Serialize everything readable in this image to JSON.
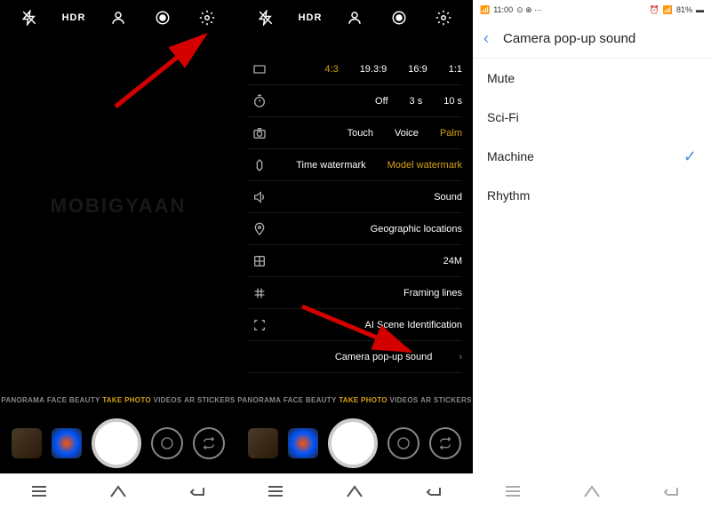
{
  "panel1": {
    "topbar": {
      "hdr": "HDR"
    },
    "modes": {
      "panorama": "PANORAMA",
      "facebeauty": "FACE BEAUTY",
      "takephoto": "TAKE PHOTO",
      "videos": "VIDEOS",
      "arstickers": "AR STICKERS"
    },
    "watermark": "MOBIGYAAN"
  },
  "panel2": {
    "topbar": {
      "hdr": "HDR"
    },
    "settings": {
      "ratio": {
        "o1": "4:3",
        "o2": "19.3:9",
        "o3": "16:9",
        "o4": "1:1"
      },
      "timer": {
        "o1": "Off",
        "o2": "3 s",
        "o3": "10 s"
      },
      "shutter": {
        "o1": "Touch",
        "o2": "Voice",
        "o3": "Palm"
      },
      "watermark": {
        "o1": "Time watermark",
        "o2": "Model watermark"
      },
      "sound": "Sound",
      "geo": "Geographic locations",
      "resolution": "24M",
      "framing": "Framing lines",
      "aiscene": "AI Scene Identification",
      "popup": "Camera pop-up sound"
    },
    "modes": {
      "panorama": "PANORAMA",
      "facebeauty": "FACE BEAUTY",
      "takephoto": "TAKE PHOTO",
      "videos": "VIDEOS",
      "arstickers": "AR STICKERS"
    }
  },
  "panel3": {
    "status": {
      "time": "11:00",
      "battery": "81%"
    },
    "title": "Camera pop-up sound",
    "options": {
      "mute": "Mute",
      "scifi": "Sci-Fi",
      "machine": "Machine",
      "rhythm": "Rhythm"
    },
    "selected": "machine"
  }
}
